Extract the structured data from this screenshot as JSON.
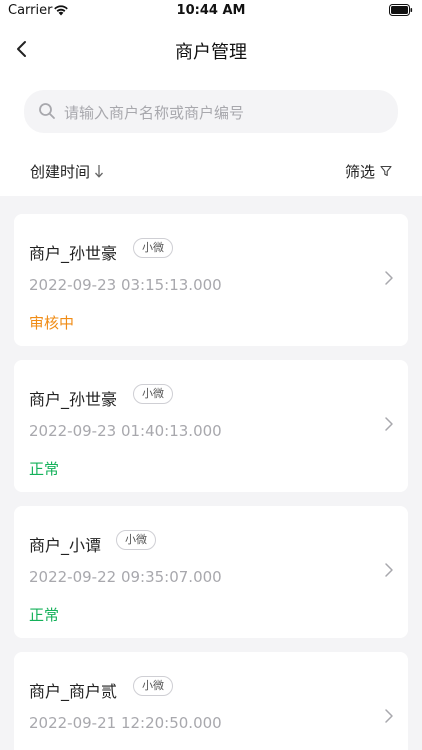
{
  "status_bar": {
    "carrier": "Carrier",
    "time": "10:44 AM"
  },
  "nav": {
    "title": "商户管理"
  },
  "search": {
    "placeholder": "请输入商户名称或商户编号",
    "value": ""
  },
  "filters": {
    "sort_label": "创建时间",
    "filter_label": "筛选"
  },
  "colors": {
    "pending": "#f08c16",
    "normal": "#14b15a"
  },
  "merchants": [
    {
      "name": "商户_孙世豪",
      "tag": "小微",
      "time": "2022-09-23 03:15:13.000",
      "status": "审核中"
    },
    {
      "name": "商户_孙世豪",
      "tag": "小微",
      "time": "2022-09-23 01:40:13.000",
      "status": "正常"
    },
    {
      "name": "商户_小谭",
      "tag": "小微",
      "time": "2022-09-22 09:35:07.000",
      "status": "正常"
    },
    {
      "name": "商户_商户贰",
      "tag": "小微",
      "time": "2022-09-21 12:20:50.000",
      "status": ""
    }
  ]
}
